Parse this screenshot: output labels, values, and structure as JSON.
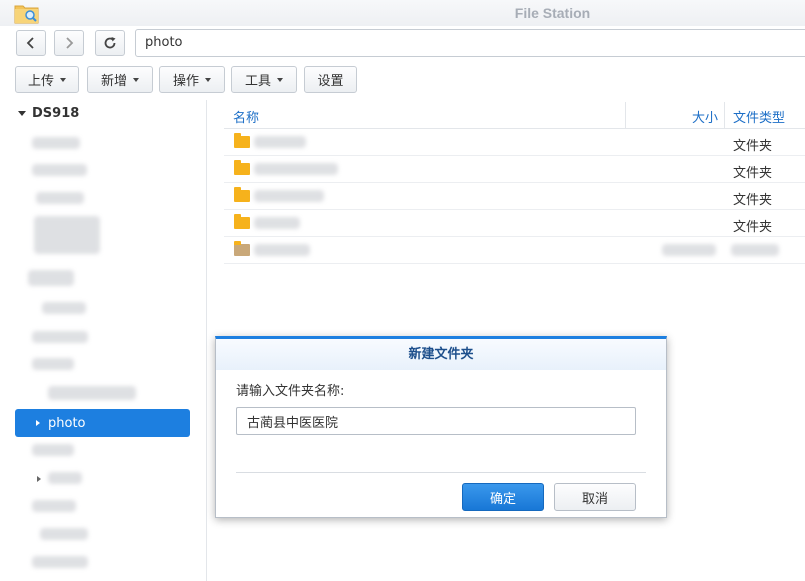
{
  "window": {
    "title": "File Station",
    "app_icon": "folder-search-icon"
  },
  "nav": {
    "back_icon": "chevron-left-icon",
    "forward_icon": "chevron-right-icon",
    "refresh_icon": "refresh-icon",
    "path": "photo"
  },
  "toolbar": {
    "upload": "上传",
    "create": "新增",
    "action": "操作",
    "tools": "工具",
    "settings": "设置"
  },
  "tree": {
    "root": "DS918",
    "selected": "photo"
  },
  "list": {
    "columns": {
      "name": "名称",
      "size": "大小",
      "type": "文件类型"
    },
    "rows": [
      {
        "type": "文件夹"
      },
      {
        "type": "文件夹"
      },
      {
        "type": "文件夹"
      },
      {
        "type": "文件夹"
      }
    ]
  },
  "dialog": {
    "title": "新建文件夹",
    "prompt": "请输入文件夹名称:",
    "input_value": "古蔺县中医医院",
    "ok": "确定",
    "cancel": "取消"
  },
  "colors": {
    "accent": "#1d7fe0",
    "header_text": "#1d6fc7",
    "folder": "#f6b21c"
  }
}
